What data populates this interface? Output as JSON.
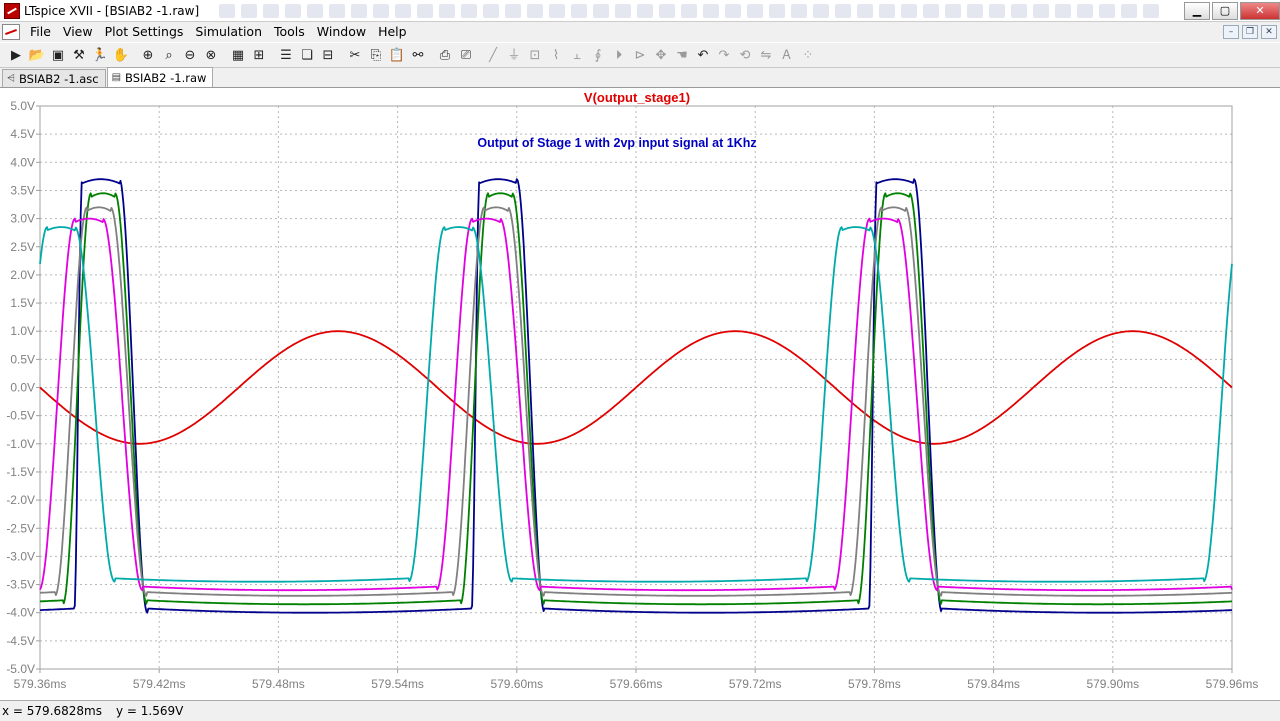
{
  "window": {
    "title": "LTspice XVII - [BSIAB2 -1.raw]"
  },
  "menu": [
    "File",
    "View",
    "Plot Settings",
    "Simulation",
    "Tools",
    "Window",
    "Help"
  ],
  "tabs": [
    {
      "label": "BSIAB2 -1.asc",
      "icon": "schematic-icon"
    },
    {
      "label": "BSIAB2 -1.raw",
      "icon": "waveform-icon"
    }
  ],
  "status": {
    "x_readout": "x = 579.6828ms",
    "y_readout": "y = 1.569V"
  },
  "colors": {
    "title": "#e00000",
    "annotation": "#0000c0",
    "axis_text": "#808080",
    "grid": "#b8b8b8"
  },
  "chart_data": {
    "type": "line",
    "title": "V(output_stage1)",
    "annotation": "Output of Stage 1 with 2vp input signal at 1Khz",
    "xlabel": "",
    "ylabel": "",
    "x_ticks": [
      "579.36ms",
      "579.42ms",
      "579.48ms",
      "579.54ms",
      "579.60ms",
      "579.66ms",
      "579.72ms",
      "579.78ms",
      "579.84ms",
      "579.90ms",
      "579.96ms"
    ],
    "y_ticks": [
      "5.0V",
      "4.5V",
      "4.0V",
      "3.5V",
      "3.0V",
      "2.5V",
      "2.0V",
      "1.5V",
      "1.0V",
      "0.5V",
      "0.0V",
      "-0.5V",
      "-1.0V",
      "-1.5V",
      "-2.0V",
      "-2.5V",
      "-3.0V",
      "-3.5V",
      "-4.0V",
      "-4.5V",
      "-5.0V"
    ],
    "xlim": [
      579.36,
      579.96
    ],
    "ylim": [
      -5.0,
      5.0
    ],
    "grid": true,
    "series": [
      {
        "color": "#e00000",
        "kind": "sine",
        "amplitude": 1.0,
        "period": 0.2,
        "cross_up": 579.46
      },
      {
        "color": "#00008c",
        "kind": "clipped",
        "high": 3.7,
        "low": -4.0,
        "period": 0.2,
        "rise_start": 579.5772,
        "fall_start": 579.6,
        "rise_width": 0.004,
        "fall_width": 0.014
      },
      {
        "color": "#008000",
        "kind": "clipped",
        "high": 3.45,
        "low": -3.85,
        "period": 0.2,
        "rise_start": 579.5716,
        "fall_start": 579.5978,
        "rise_width": 0.014,
        "fall_width": 0.016
      },
      {
        "color": "#808080",
        "kind": "clipped",
        "high": 3.2,
        "low": -3.7,
        "period": 0.2,
        "rise_start": 579.5676,
        "fall_start": 579.5956,
        "rise_width": 0.016,
        "fall_width": 0.018
      },
      {
        "color": "#e000e0",
        "kind": "clipped",
        "high": 3.0,
        "low": -3.6,
        "period": 0.2,
        "rise_start": 579.5596,
        "fall_start": 579.5916,
        "rise_width": 0.018,
        "fall_width": 0.02
      },
      {
        "color": "#00aaaa",
        "kind": "clipped",
        "high": 2.85,
        "low": -3.45,
        "period": 0.2,
        "rise_start": 579.5456,
        "fall_start": 579.5776,
        "rise_width": 0.018,
        "fall_width": 0.02
      }
    ]
  }
}
